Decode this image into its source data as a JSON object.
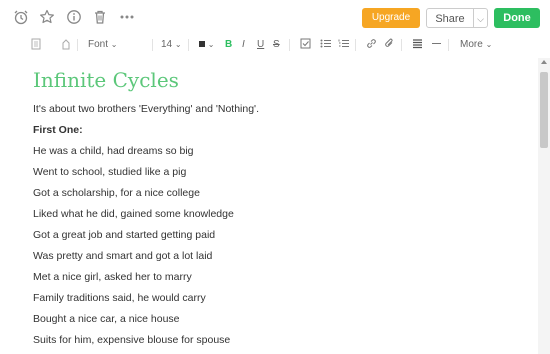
{
  "topbar": {
    "icons": [
      "alarm-clock-icon",
      "star-icon",
      "info-icon",
      "trash-icon",
      "more-dots-icon"
    ],
    "upgrade_label": "Upgrade",
    "share_label": "Share",
    "done_label": "Done"
  },
  "format_toolbar": {
    "font_label": "Font",
    "size_label": "14",
    "more_label": "More",
    "bold_label": "B",
    "italic_label": "I",
    "underline_label": "U",
    "strike_label": "S",
    "accent_color": "#2dbe60"
  },
  "note": {
    "title": "Infinite Cycles",
    "lines": [
      "It's about two brothers 'Everything' and 'Nothing'.",
      "First One:",
      "He was a child, had dreams so big",
      "Went to school, studied like a pig",
      "Got a scholarship, for a nice college",
      "Liked what he did, gained some knowledge",
      "Got a great job and started getting paid",
      "Was pretty and smart and got a lot laid",
      "Met a nice girl, asked her to marry",
      "Family traditions said, he would carry",
      "Bought a nice car, a nice house",
      "Suits for him, expensive blouse for spouse"
    ]
  },
  "colors": {
    "upgrade": "#f6a623",
    "done": "#2dbe60",
    "title": "#5cc77a"
  }
}
